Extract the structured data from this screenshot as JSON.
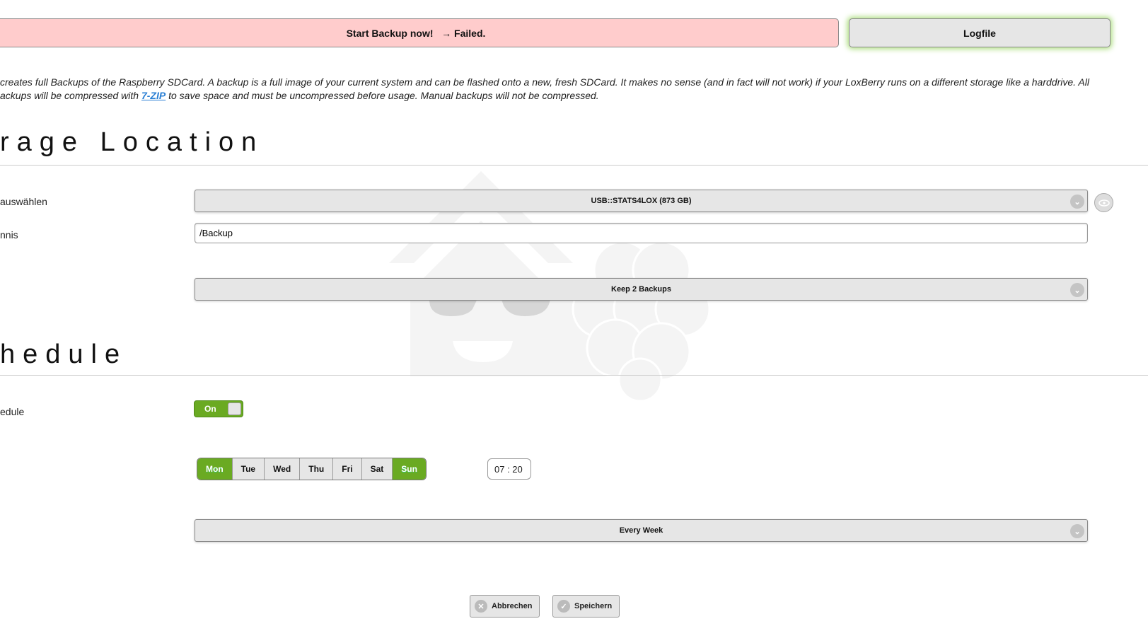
{
  "top": {
    "start_label": "Start Backup now!",
    "start_status": "→ Failed.",
    "logfile_label": "Logfile"
  },
  "description": {
    "line1": "creates full Backups of the Raspberry SDCard. A backup is a full image of your current system and can be flashed onto a new, fresh SDCard. It makes no sense (and in fact will not work) if your LoxBerry runs on a different storage like a harddrive. All",
    "line2_pre": "ackups will be compressed with ",
    "link": "7-ZIP",
    "line2_post": " to save space and must be uncompressed before usage. Manual backups will not be compressed."
  },
  "storage": {
    "heading": "rage Location",
    "device_label": "auswählen",
    "device_value": "USB::STATS4LOX (873 GB)",
    "dir_label": "nnis",
    "dir_value": "/Backup",
    "retention_value": "Keep 2 Backups"
  },
  "schedule": {
    "heading": "hedule",
    "enable_label": "edule",
    "toggle_label": "On",
    "toggle_on": true,
    "days": [
      {
        "label": "Mon",
        "on": true
      },
      {
        "label": "Tue",
        "on": false
      },
      {
        "label": "Wed",
        "on": false
      },
      {
        "label": "Thu",
        "on": false
      },
      {
        "label": "Fri",
        "on": false
      },
      {
        "label": "Sat",
        "on": false
      },
      {
        "label": "Sun",
        "on": true
      }
    ],
    "time": "07 : 20",
    "repeat_value": "Every Week"
  },
  "footer": {
    "cancel_label": "Abbrechen",
    "save_label": "Speichern"
  },
  "colors": {
    "accent": "#6aaa22",
    "failed_bg": "#ffcccc"
  }
}
